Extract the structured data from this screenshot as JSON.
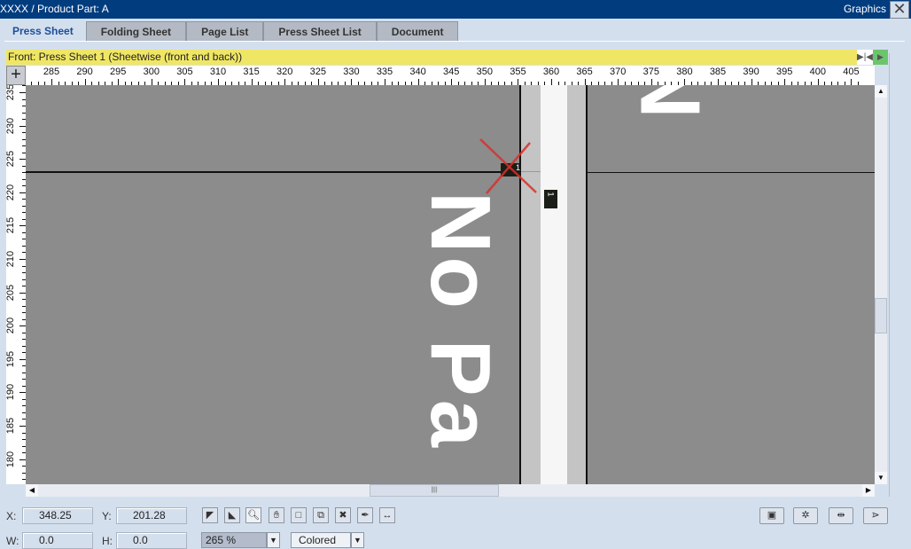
{
  "window": {
    "title": "XXXX / Product Part: A",
    "right_label": "Graphics",
    "close_glyph": "✕"
  },
  "tabs": [
    {
      "label": "Press Sheet",
      "active": true
    },
    {
      "label": "Folding Sheet"
    },
    {
      "label": "Page List"
    },
    {
      "label": "Press Sheet List"
    },
    {
      "label": "Document"
    }
  ],
  "sheet_bar": {
    "label": "Front:  Press Sheet 1 (Sheetwise (front and back))"
  },
  "ruler": {
    "h_start": 285,
    "h_end": 405,
    "v_start": 235,
    "v_end": 180,
    "step": 5
  },
  "canvas": {
    "watermark": "No Pa",
    "watermark_top": "N",
    "mark_label": "1"
  },
  "coords": {
    "x_label": "X:",
    "x_value": "348.25",
    "y_label": "Y:",
    "y_value": "201.28",
    "w_label": "W:",
    "w_value": "0.0",
    "h_label": "H:",
    "h_value": "0.0"
  },
  "zoom": {
    "value": "265 %"
  },
  "color_mode": {
    "value": "Colored"
  },
  "tools": [
    "select-arrow",
    "select-subarrow",
    "magnifier",
    "hand",
    "crop-frame",
    "copy-paste",
    "cross-delete",
    "pen",
    "measure"
  ],
  "right_tools": [
    "layout-view",
    "settings",
    "align-check",
    "signal"
  ]
}
